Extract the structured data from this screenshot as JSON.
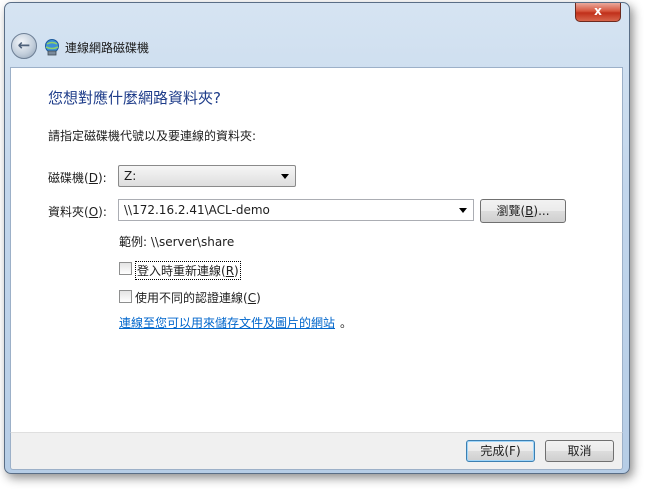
{
  "window": {
    "title": "連線網路磁碟機",
    "close_glyph": "x"
  },
  "main": {
    "heading": "您想對應什麼網路資料夾?",
    "instruction": "請指定磁碟機代號以及要連線的資料夾:",
    "drive": {
      "label": "磁碟機",
      "accesskey": "D",
      "label_suffix": "):",
      "value": "Z:"
    },
    "folder": {
      "label": "資料夾",
      "accesskey": "O",
      "label_suffix": "):",
      "value": "\\\\172.16.2.41\\ACL-demo"
    },
    "browse": {
      "label": "瀏覽",
      "accesskey": "B",
      "suffix": ")..."
    },
    "example": "範例: \\\\server\\share",
    "reconnect": {
      "label": "登入時重新連線",
      "accesskey": "R",
      "checked": false
    },
    "diff_creds": {
      "label": "使用不同的認證連線",
      "accesskey": "C",
      "checked": false
    },
    "link": "連線至您可以用來儲存文件及圖片的網站",
    "link_suffix": "。"
  },
  "footer": {
    "finish": "完成(F)",
    "cancel": "取消"
  },
  "colors": {
    "heading": "#1f3d8a",
    "link": "#0066cc",
    "close_button": "#c7402a"
  },
  "icons": {
    "back": "back-arrow-icon",
    "title": "network-drive-icon",
    "dropdown": "chevron-down-icon"
  }
}
